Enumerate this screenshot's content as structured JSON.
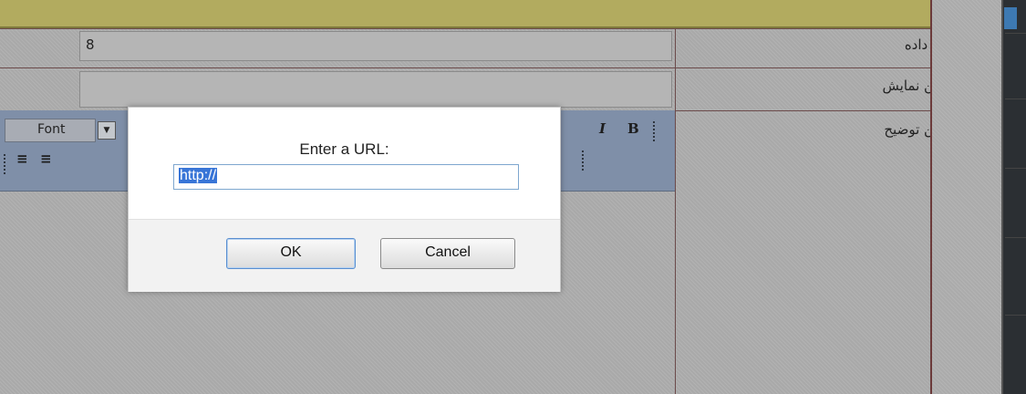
{
  "form": {
    "data_code_label": "کد داده",
    "data_code_value": "8",
    "display_text_label": "متن نمایش",
    "display_text_value": "",
    "description_label": "متن توضیح"
  },
  "editor_toolbar": {
    "font_label": "Font",
    "italic_glyph": "I",
    "bold_glyph": "B",
    "align_left_glyph": "≡",
    "align_center_glyph": "≡"
  },
  "dialog": {
    "message": "Enter a URL:",
    "input_value": "http://",
    "ok_label": "OK",
    "cancel_label": "Cancel"
  },
  "colors": {
    "overlay": "#a9a9a9",
    "title_strip": "#b2ab5f",
    "toolbar": "#7f8fa8",
    "selection": "#3875d7",
    "scroll_rail": "#2b2f33"
  }
}
